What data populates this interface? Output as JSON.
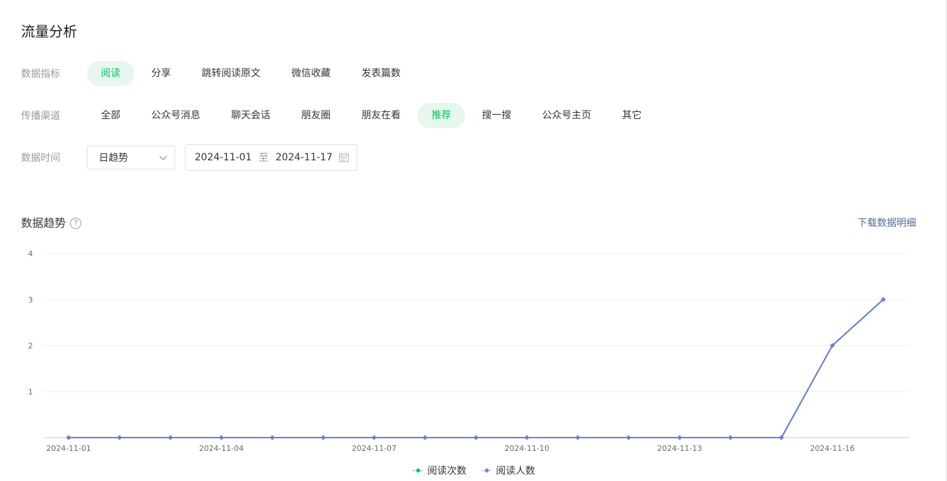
{
  "page": {
    "title": "流量分析"
  },
  "filters": {
    "metric": {
      "label": "数据指标",
      "options": [
        "阅读",
        "分享",
        "跳转阅读原文",
        "微信收藏",
        "发表篇数"
      ],
      "active_index": 0
    },
    "channel": {
      "label": "传播渠道",
      "options": [
        "全部",
        "公众号消息",
        "聊天会话",
        "朋友圈",
        "朋友在看",
        "推荐",
        "搜一搜",
        "公众号主页",
        "其它"
      ],
      "active_index": 5
    },
    "time": {
      "label": "数据时间",
      "granularity": "日趋势",
      "start_date": "2024-11-01",
      "range_separator": "至",
      "end_date": "2024-11-17"
    }
  },
  "trend": {
    "title": "数据趋势",
    "help_icon_text": "?",
    "download_label": "下载数据明细"
  },
  "colors": {
    "accent_green": "#07c160",
    "active_bg": "#e7f7ee",
    "series_blue": "#6f7fcf",
    "link_blue": "#576b95"
  },
  "chart_data": {
    "type": "line",
    "x": [
      "2024-11-01",
      "2024-11-02",
      "2024-11-03",
      "2024-11-04",
      "2024-11-05",
      "2024-11-06",
      "2024-11-07",
      "2024-11-08",
      "2024-11-09",
      "2024-11-10",
      "2024-11-11",
      "2024-11-12",
      "2024-11-13",
      "2024-11-14",
      "2024-11-15",
      "2024-11-16",
      "2024-11-17"
    ],
    "x_tick_labels": [
      "2024-11-01",
      "2024-11-04",
      "2024-11-07",
      "2024-11-10",
      "2024-11-13",
      "2024-11-16"
    ],
    "y_ticks": [
      "1",
      "2",
      "3",
      "4"
    ],
    "ylim": [
      0,
      4
    ],
    "grid": true,
    "legend_position": "bottom-center",
    "series": [
      {
        "name": "阅读次数",
        "color": "#07c160",
        "values": [
          0,
          0,
          0,
          0,
          0,
          0,
          0,
          0,
          0,
          0,
          0,
          0,
          0,
          0,
          0,
          2,
          3
        ],
        "hidden_behind_next": true
      },
      {
        "name": "阅读人数",
        "color": "#6f7fcf",
        "values": [
          0,
          0,
          0,
          0,
          0,
          0,
          0,
          0,
          0,
          0,
          0,
          0,
          0,
          0,
          0,
          2,
          3
        ]
      }
    ]
  }
}
